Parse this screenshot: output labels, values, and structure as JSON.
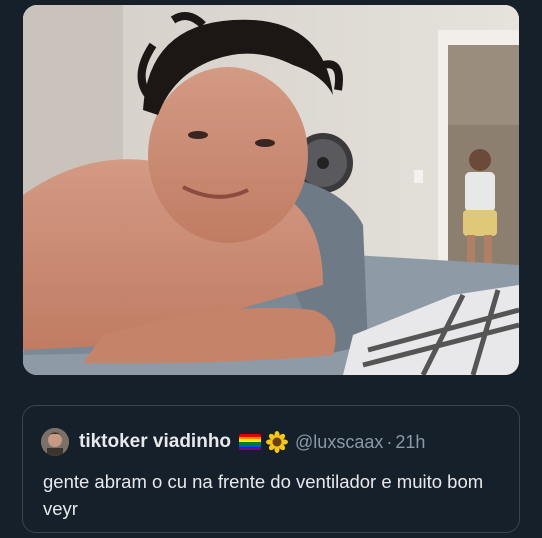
{
  "tweet": {
    "display_name": "tiktoker viadinho",
    "handle": "@luxscaax",
    "separator": "·",
    "time": "21h",
    "text": "gente abram o cu na frente do ventilador e muito bom veyr"
  },
  "icons": {
    "flag": "rainbow-flag-icon",
    "flower": "sunflower-icon"
  },
  "colors": {
    "background": "#15202b",
    "border": "#38444d",
    "text": "#e7e9ea",
    "secondary": "#8b98a5"
  }
}
